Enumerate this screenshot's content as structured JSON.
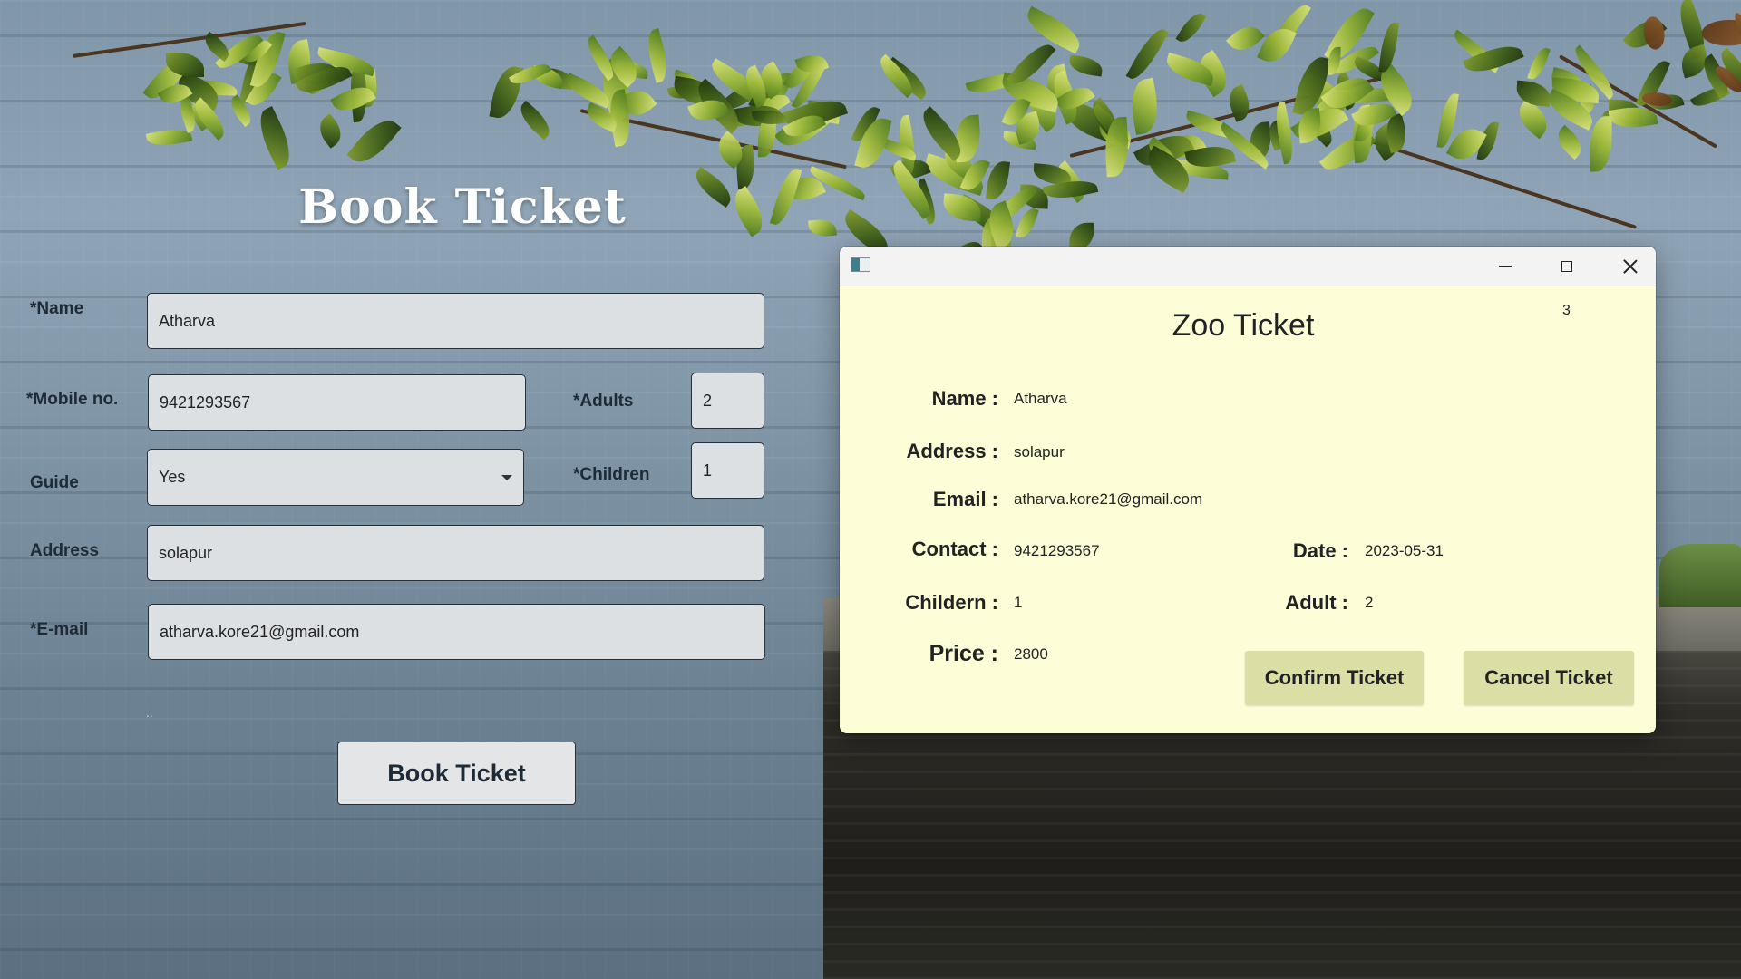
{
  "form": {
    "title": "Book Ticket",
    "name_label": "*Name",
    "name_value": "Atharva",
    "mobile_label": "*Mobile no.",
    "mobile_value": "9421293567",
    "adults_label": "*Adults",
    "adults_value": "2",
    "guide_label": "Guide",
    "guide_value": "Yes",
    "children_label": "*Children",
    "children_value": "1",
    "address_label": "Address",
    "address_value": "solapur",
    "email_label": "*E-mail",
    "email_value": "atharva.kore21@gmail.com",
    "book_button": "Book Ticket",
    "stray_mark": ".."
  },
  "ticket": {
    "title": "Zoo Ticket",
    "ticket_number": "3",
    "name_label": "Name :",
    "name_value": "Atharva",
    "address_label": "Address :",
    "address_value": "solapur",
    "email_label": "Email :",
    "email_value": "atharva.kore21@gmail.com",
    "contact_label": "Contact :",
    "contact_value": "9421293567",
    "date_label": "Date :",
    "date_value": "2023-05-31",
    "children_label": "Childern :",
    "children_value": "1",
    "adult_label": "Adult :",
    "adult_value": "2",
    "price_label": "Price :",
    "price_value": "2800",
    "confirm_button": "Confirm Ticket",
    "cancel_button": "Cancel Ticket"
  },
  "window": {
    "icons": [
      "app-icon",
      "minimize-icon",
      "maximize-icon",
      "close-icon"
    ]
  },
  "colors": {
    "ticket_background": "#fdfed8",
    "ticket_button": "#dcdfa5",
    "form_input": "#dde0e3"
  }
}
